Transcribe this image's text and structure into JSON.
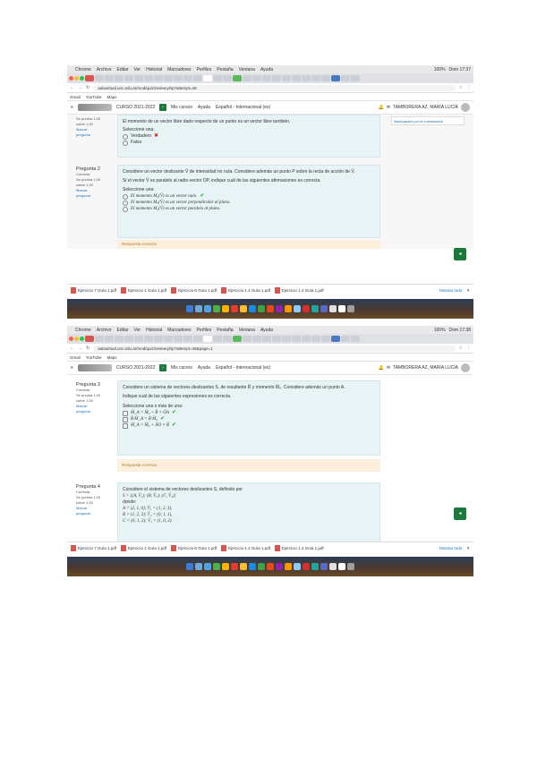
{
  "screens": [
    {
      "menubar": [
        "Chrome",
        "Archivo",
        "Editar",
        "Ver",
        "Historial",
        "Marcadores",
        "Perfiles",
        "Pestaña",
        "Ventana",
        "Ayuda"
      ],
      "menubar_right": [
        "100%",
        "Dom 17:37"
      ],
      "url": "aulavirtual.unc.edu.ar/mod/quiz/review.php?attempt=48",
      "bookmarks": [
        "Gmail",
        "YouTube",
        "Maps"
      ],
      "moodle_nav": {
        "course": "CURSO 2021-2022",
        "links": [
          "Mis cursos",
          "Ayuda",
          "Español - Internacional (es)"
        ],
        "user": "TAMBORERA AZ, MARÍA LUCÍA"
      },
      "side_panel": "Navegación por el cuestionario",
      "q_prev": {
        "info": [
          "Se puntúa 1,00",
          "sobre 1,00",
          "Marcar",
          "pregunta"
        ],
        "text": "El momento de un vector libre dado respecto de un punto es un vector libre también.",
        "prompt": "Seleccione una:",
        "options": [
          {
            "label": "Verdadero",
            "mark": "✖"
          },
          {
            "label": "Falso",
            "mark": ""
          }
        ]
      },
      "q_main": {
        "info": [
          "Pregunta 2",
          "Correcta",
          "Se puntúa 1,00",
          "sobre 1,00",
          "Marcar",
          "pregunta"
        ],
        "lines": [
          "Considere un vector deslizante V̄ de intensidad no nula. Considere además un punto P sobre la recta de acción de V̄.",
          "Si el vector V̄ es paralelo al radio-vector OP, indique cuál de las siguientes afirmaciones es correcta."
        ],
        "prompt": "Seleccione una:",
        "options": [
          {
            "label": "El momento M₀(V̄) es un vector nulo.",
            "mark": "✔"
          },
          {
            "label": "El momento M₀(V̄) es un vector perpendicular al plano.",
            "mark": ""
          },
          {
            "label": "El momento M₀(V̄) es un vector paralelo al plano.",
            "mark": ""
          }
        ],
        "feedback": "Respuesta correcta"
      },
      "downloads": [
        "Ejercicio 7 Guía 1.pdf",
        "Ejercicio 1 Guía 1.pdf",
        "Ejercicio 6 Guía 1.pdf",
        "Ejercicio 1.4 Guía 1.pdf",
        "Ejercicio 1.4 Guía 1.pdf"
      ],
      "show_all": "Mostrar todo"
    },
    {
      "menubar": [
        "Chrome",
        "Archivo",
        "Editar",
        "Ver",
        "Historial",
        "Marcadores",
        "Perfiles",
        "Pestaña",
        "Ventana",
        "Ayuda"
      ],
      "menubar_right": [
        "100%",
        "Dom 17:38"
      ],
      "url": "aulavirtual.unc.edu.ar/mod/quiz/review.php?attempt=48&page=1",
      "bookmarks": [
        "Gmail",
        "YouTube",
        "Maps"
      ],
      "moodle_nav": {
        "course": "CURSO 2021-2022",
        "links": [
          "Mis cursos",
          "Ayuda",
          "Español - Internacional (es)"
        ],
        "user": "TAMBORERA AZ, MARÍA LUCÍA"
      },
      "q_main": {
        "info": [
          "Pregunta 3",
          "Correcta",
          "Se puntúa 1,00",
          "sobre 1,00",
          "Marcar",
          "pregunta"
        ],
        "lines": [
          "Considere un sistema de vectores deslizantes S, de resultante R̄ y momento M̄₀. Considere además un punto A.",
          "Indique cuál de las siguientes expresiones es correcta."
        ],
        "prompt": "Seleccione una o más de una:",
        "options": [
          {
            "label": "M̄_A = M̄₀ + R̄ × ŌA",
            "mark": "✔"
          },
          {
            "label": "R̄·M̄_A = R̄·M̄₀",
            "mark": "✔"
          },
          {
            "label": "M̄_A = M̄₀ + ĀO × R̄",
            "mark": "✔"
          }
        ],
        "feedback": "Respuesta correcta"
      },
      "q_next": {
        "info": [
          "Pregunta 4",
          "Correcta",
          "Se puntúa 1,00",
          "sobre 1,00",
          "Marcar",
          "pregunta"
        ],
        "lines": [
          "Considere el sistema de vectores deslizantes S, definido por",
          "S = {(A, V̄₁); (B, V̄₂); (C, V̄₃)}",
          "donde:",
          "A = (2, 1, 0); V̄₁ = (1, 2, 3),",
          "B = (1, 2, 3); V̄₂ = (0, 1, 1),",
          "C = (0, 1, 2); V̄₃ = (1, 0, 2)."
        ]
      },
      "downloads": [
        "Ejercicio 7 Guía 1.pdf",
        "Ejercicio 1 Guía 1.pdf",
        "Ejercicio 6 Guía 1.pdf",
        "Ejercicio 1.4 Guía 1.pdf",
        "Ejercicio 1.4 Guía 1.pdf"
      ],
      "show_all": "Mostrar todo"
    }
  ],
  "colors": {
    "accent": "#1a7a3c",
    "question_bg": "#e7f3f5",
    "feedback_bg": "#fcefdc",
    "correct": "#2a9b2a",
    "incorrect": "#dd2222"
  }
}
